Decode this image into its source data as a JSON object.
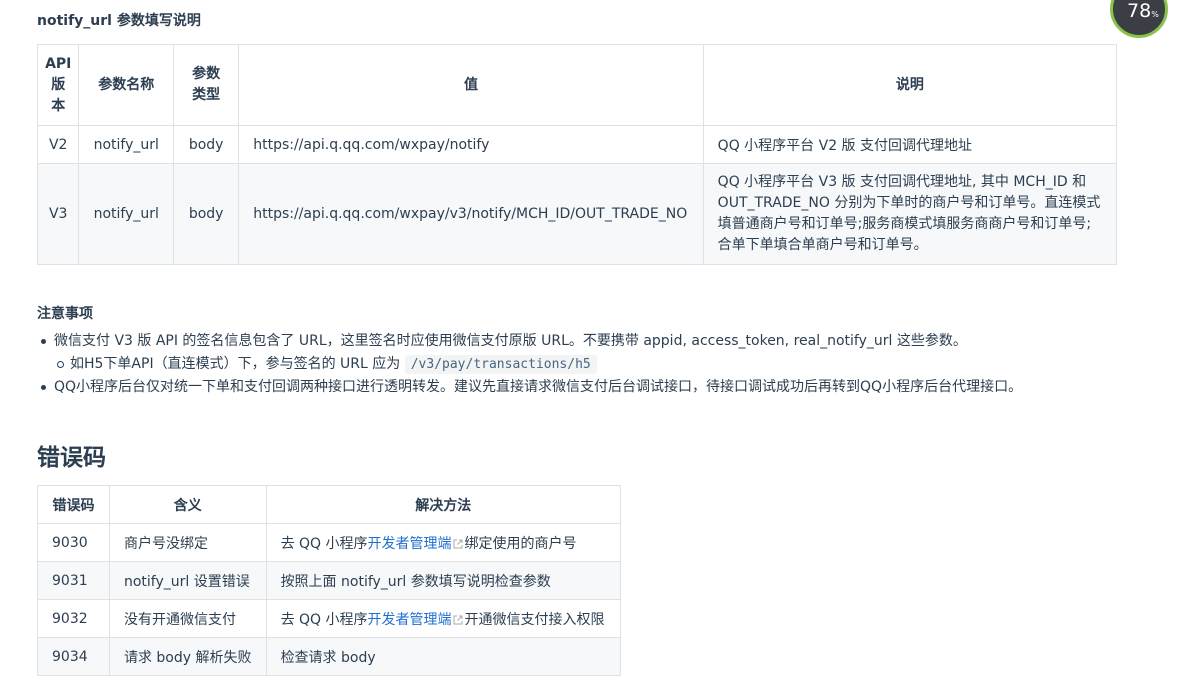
{
  "param_section": {
    "title": "notify_url 参数填写说明",
    "headers": {
      "version_line1": "API",
      "version_line2": "版",
      "version_line3": "本",
      "name_line1": "参数名称",
      "type_line1": "参数",
      "type_line2": "类型",
      "value": "值",
      "desc": "说明"
    },
    "rows": [
      {
        "version": "V2",
        "name": "notify_url",
        "type": "body",
        "value": "https://api.q.qq.com/wxpay/notify",
        "desc_lines": [
          "QQ 小程序平台 V2 版 支付回调代理地址"
        ]
      },
      {
        "version": "V3",
        "name": "notify_url",
        "type": "body",
        "value": "https://api.q.qq.com/wxpay/v3/notify/MCH_ID/OUT_TRADE_NO",
        "desc_lines": [
          "QQ 小程序平台 V3 版 支付回调代理地址, 其中 MCH_ID 和",
          "OUT_TRADE_NO 分别为下单时的商户号和订单号。直连模式",
          "填普通商户号和订单号;服务商模式填服务商商户号和订单号;",
          "合单下单填合单商户号和订单号。"
        ]
      }
    ]
  },
  "notes": {
    "title": "注意事项",
    "item1": "微信支付 V3 版 API 的签名信息包含了 URL，这里签名时应使用微信支付原版 URL。不要携带 appid, access_token, real_notify_url 这些参数。",
    "item1_sub_prefix": "如H5下单API（直连模式）下，参与签名的 URL 应为",
    "item1_sub_code": "/v3/pay/transactions/h5",
    "item2": "QQ小程序后台仅对统一下单和支付回调两种接口进行透明转发。建议先直接请求微信支付后台调试接口，待接口调试成功后再转到QQ小程序后台代理接口。"
  },
  "errors": {
    "heading": "错误码",
    "headers": {
      "code": "错误码",
      "meaning": "含义",
      "fix": "解决方法"
    },
    "rows": [
      {
        "code": "9030",
        "meaning": "商户号没绑定",
        "fix_prefix": "去 QQ 小程序",
        "fix_link": "开发者管理端",
        "fix_suffix": "绑定使用的商户号"
      },
      {
        "code": "9031",
        "meaning": "notify_url 设置错误",
        "fix_prefix": "按照上面 notify_url 参数填写说明检查参数",
        "fix_link": "",
        "fix_suffix": ""
      },
      {
        "code": "9032",
        "meaning": "没有开通微信支付",
        "fix_prefix": "去 QQ 小程序",
        "fix_link": "开发者管理端",
        "fix_suffix": "开通微信支付接入权限"
      },
      {
        "code": "9034",
        "meaning": "请求 body 解析失败",
        "fix_prefix": "检查请求 body",
        "fix_link": "",
        "fix_suffix": ""
      }
    ]
  },
  "overlay": {
    "value": "78",
    "unit": "%"
  },
  "colors": {
    "link": "#1e6fd0",
    "text": "#2c3e50",
    "border": "#dfe2e5",
    "stripe": "#f6f8fa"
  }
}
